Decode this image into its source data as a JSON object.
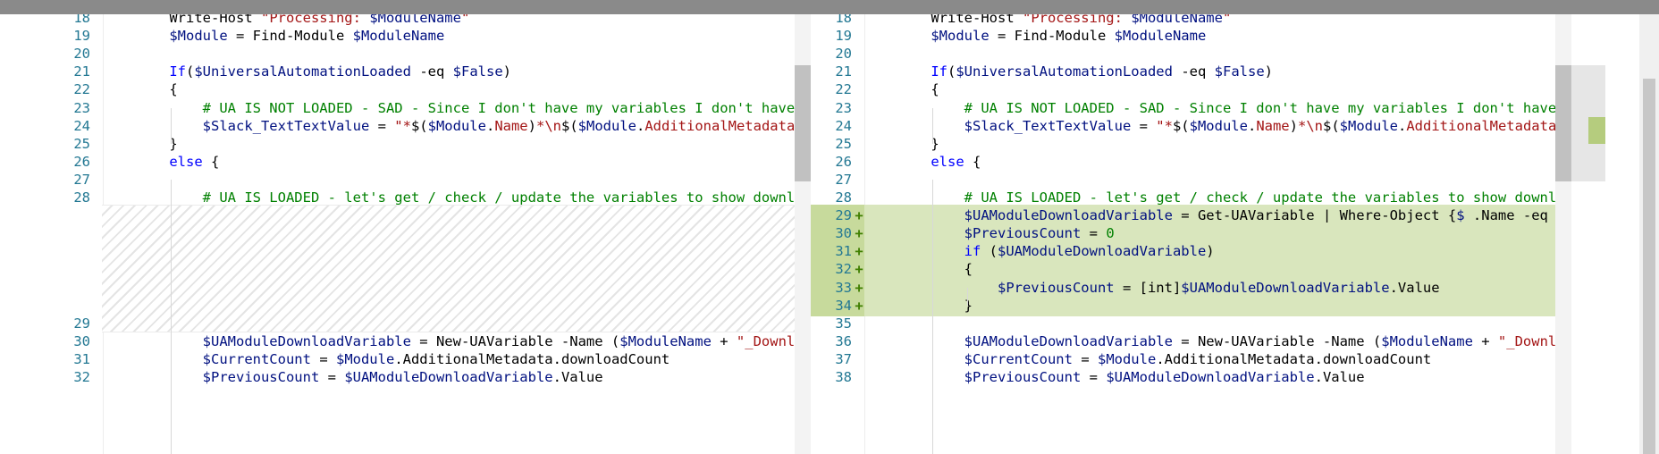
{
  "diff": {
    "left": {
      "lines": [
        {
          "num": "18",
          "segments": [
            {
              "t": "    Write-Host ",
              "c": "op"
            },
            {
              "t": "\"Processing: ",
              "c": "str"
            },
            {
              "t": "$ModuleName",
              "c": "var"
            },
            {
              "t": "\"",
              "c": "str"
            }
          ]
        },
        {
          "num": "19",
          "segments": [
            {
              "t": "    ",
              "c": "op"
            },
            {
              "t": "$Module",
              "c": "var"
            },
            {
              "t": " = Find-Module ",
              "c": "op"
            },
            {
              "t": "$ModuleName",
              "c": "var"
            }
          ]
        },
        {
          "num": "20",
          "segments": []
        },
        {
          "num": "21",
          "segments": [
            {
              "t": "    ",
              "c": "op"
            },
            {
              "t": "If",
              "c": "kw"
            },
            {
              "t": "(",
              "c": "op"
            },
            {
              "t": "$UniversalAutomationLoaded",
              "c": "var"
            },
            {
              "t": " -eq ",
              "c": "op"
            },
            {
              "t": "$False",
              "c": "var"
            },
            {
              "t": ")",
              "c": "op"
            }
          ]
        },
        {
          "num": "22",
          "segments": [
            {
              "t": "    {",
              "c": "op"
            }
          ]
        },
        {
          "num": "23",
          "segments": [
            {
              "t": "        # UA IS NOT LOADED - SAD - Since I don't have my variables I don't have a d",
              "c": "com"
            }
          ]
        },
        {
          "num": "24",
          "segments": [
            {
              "t": "        ",
              "c": "op"
            },
            {
              "t": "$Slack_TextTextValue",
              "c": "var"
            },
            {
              "t": " = ",
              "c": "op"
            },
            {
              "t": "\"*",
              "c": "str"
            },
            {
              "t": "$(",
              "c": "op"
            },
            {
              "t": "$Module",
              "c": "var"
            },
            {
              "t": ".",
              "c": "op"
            },
            {
              "t": "Name",
              "c": "str"
            },
            {
              "t": ")",
              "c": "op"
            },
            {
              "t": "*\\n",
              "c": "str"
            },
            {
              "t": "$(",
              "c": "op"
            },
            {
              "t": "$Module",
              "c": "var"
            },
            {
              "t": ".",
              "c": "op"
            },
            {
              "t": "AdditionalMetadata",
              "c": "str"
            },
            {
              "t": ".dow",
              "c": "op"
            }
          ]
        },
        {
          "num": "25",
          "segments": [
            {
              "t": "    }",
              "c": "op"
            }
          ]
        },
        {
          "num": "26",
          "segments": [
            {
              "t": "    ",
              "c": "op"
            },
            {
              "t": "else",
              "c": "kw"
            },
            {
              "t": " {",
              "c": "op"
            }
          ]
        },
        {
          "num": "27",
          "segments": []
        },
        {
          "num": "28",
          "segments": [
            {
              "t": "        # UA IS LOADED - let's get / check / update the variables to show download",
              "c": "com"
            }
          ]
        },
        {
          "num": "29",
          "segments": []
        },
        {
          "num": "30",
          "segments": [
            {
              "t": "        ",
              "c": "op"
            },
            {
              "t": "$UAModuleDownloadVariable",
              "c": "var"
            },
            {
              "t": " = New-UAVariable -Name (",
              "c": "op"
            },
            {
              "t": "$ModuleName",
              "c": "var"
            },
            {
              "t": " + ",
              "c": "op"
            },
            {
              "t": "\"_Downloads",
              "c": "str"
            }
          ]
        },
        {
          "num": "31",
          "segments": [
            {
              "t": "        ",
              "c": "op"
            },
            {
              "t": "$CurrentCount",
              "c": "var"
            },
            {
              "t": " = ",
              "c": "op"
            },
            {
              "t": "$Module",
              "c": "var"
            },
            {
              "t": ".AdditionalMetadata.downloadCount",
              "c": "op"
            }
          ]
        },
        {
          "num": "32",
          "segments": [
            {
              "t": "        ",
              "c": "op"
            },
            {
              "t": "$PreviousCount",
              "c": "var"
            },
            {
              "t": " = ",
              "c": "op"
            },
            {
              "t": "$UAModuleDownloadVariable",
              "c": "var"
            },
            {
              "t": ".Value",
              "c": "op"
            }
          ]
        }
      ]
    },
    "right": {
      "lines": [
        {
          "num": "18",
          "mark": "",
          "segments": [
            {
              "t": "    Write-Host ",
              "c": "op"
            },
            {
              "t": "\"Processing: ",
              "c": "str"
            },
            {
              "t": "$ModuleName",
              "c": "var"
            },
            {
              "t": "\"",
              "c": "str"
            }
          ]
        },
        {
          "num": "19",
          "mark": "",
          "segments": [
            {
              "t": "    ",
              "c": "op"
            },
            {
              "t": "$Module",
              "c": "var"
            },
            {
              "t": " = Find-Module ",
              "c": "op"
            },
            {
              "t": "$ModuleName",
              "c": "var"
            }
          ]
        },
        {
          "num": "20",
          "mark": "",
          "segments": []
        },
        {
          "num": "21",
          "mark": "",
          "segments": [
            {
              "t": "    ",
              "c": "op"
            },
            {
              "t": "If",
              "c": "kw"
            },
            {
              "t": "(",
              "c": "op"
            },
            {
              "t": "$UniversalAutomationLoaded",
              "c": "var"
            },
            {
              "t": " -eq ",
              "c": "op"
            },
            {
              "t": "$False",
              "c": "var"
            },
            {
              "t": ")",
              "c": "op"
            }
          ]
        },
        {
          "num": "22",
          "mark": "",
          "segments": [
            {
              "t": "    {",
              "c": "op"
            }
          ]
        },
        {
          "num": "23",
          "mark": "",
          "segments": [
            {
              "t": "        # UA IS NOT LOADED - SAD - Since I don't have my variables I don't have a d",
              "c": "com"
            }
          ]
        },
        {
          "num": "24",
          "mark": "",
          "segments": [
            {
              "t": "        ",
              "c": "op"
            },
            {
              "t": "$Slack_TextTextValue",
              "c": "var"
            },
            {
              "t": " = ",
              "c": "op"
            },
            {
              "t": "\"*",
              "c": "str"
            },
            {
              "t": "$(",
              "c": "op"
            },
            {
              "t": "$Module",
              "c": "var"
            },
            {
              "t": ".",
              "c": "op"
            },
            {
              "t": "Name",
              "c": "str"
            },
            {
              "t": ")",
              "c": "op"
            },
            {
              "t": "*\\n",
              "c": "str"
            },
            {
              "t": "$(",
              "c": "op"
            },
            {
              "t": "$Module",
              "c": "var"
            },
            {
              "t": ".",
              "c": "op"
            },
            {
              "t": "AdditionalMetadata",
              "c": "str"
            },
            {
              "t": ".dow",
              "c": "op"
            }
          ]
        },
        {
          "num": "25",
          "mark": "",
          "segments": [
            {
              "t": "    }",
              "c": "op"
            }
          ]
        },
        {
          "num": "26",
          "mark": "",
          "segments": [
            {
              "t": "    ",
              "c": "op"
            },
            {
              "t": "else",
              "c": "kw"
            },
            {
              "t": " {",
              "c": "op"
            }
          ]
        },
        {
          "num": "27",
          "mark": "",
          "segments": []
        },
        {
          "num": "28",
          "mark": "",
          "segments": [
            {
              "t": "        # UA IS LOADED - let's get / check / update the variables to show download",
              "c": "com"
            }
          ]
        },
        {
          "num": "29",
          "mark": "+",
          "added": true,
          "segments": [
            {
              "t": "        ",
              "c": "op"
            },
            {
              "t": "$UAModuleDownloadVariable",
              "c": "var"
            },
            {
              "t": " = Get-UAVariable | Where-Object {",
              "c": "op"
            },
            {
              "t": "$_",
              "c": "var"
            },
            {
              "t": ".Name -eq (",
              "c": "op"
            },
            {
              "t": "$Mo",
              "c": "var"
            }
          ]
        },
        {
          "num": "30",
          "mark": "+",
          "added": true,
          "segments": [
            {
              "t": "        ",
              "c": "op"
            },
            {
              "t": "$PreviousCount",
              "c": "var"
            },
            {
              "t": " = ",
              "c": "op"
            },
            {
              "t": "0",
              "c": "com"
            }
          ]
        },
        {
          "num": "31",
          "mark": "+",
          "added": true,
          "segments": [
            {
              "t": "        ",
              "c": "op"
            },
            {
              "t": "if",
              "c": "kw"
            },
            {
              "t": " (",
              "c": "op"
            },
            {
              "t": "$UAModuleDownloadVariable",
              "c": "var"
            },
            {
              "t": ")",
              "c": "op"
            }
          ]
        },
        {
          "num": "32",
          "mark": "+",
          "added": true,
          "segments": [
            {
              "t": "        {",
              "c": "op"
            }
          ]
        },
        {
          "num": "33",
          "mark": "+",
          "added": true,
          "segments": [
            {
              "t": "            ",
              "c": "op"
            },
            {
              "t": "$PreviousCount",
              "c": "var"
            },
            {
              "t": " = [int]",
              "c": "op"
            },
            {
              "t": "$UAModuleDownloadVariable",
              "c": "var"
            },
            {
              "t": ".Value",
              "c": "op"
            }
          ]
        },
        {
          "num": "34",
          "mark": "+",
          "added": true,
          "segments": [
            {
              "t": "        }",
              "c": "op"
            }
          ]
        },
        {
          "num": "35",
          "mark": "",
          "segments": []
        },
        {
          "num": "36",
          "mark": "",
          "segments": [
            {
              "t": "        ",
              "c": "op"
            },
            {
              "t": "$UAModuleDownloadVariable",
              "c": "var"
            },
            {
              "t": " = New-UAVariable -Name (",
              "c": "op"
            },
            {
              "t": "$ModuleName",
              "c": "var"
            },
            {
              "t": " + ",
              "c": "op"
            },
            {
              "t": "\"_Downloads",
              "c": "str"
            }
          ]
        },
        {
          "num": "37",
          "mark": "",
          "segments": [
            {
              "t": "        ",
              "c": "op"
            },
            {
              "t": "$CurrentCount",
              "c": "var"
            },
            {
              "t": " = ",
              "c": "op"
            },
            {
              "t": "$Module",
              "c": "var"
            },
            {
              "t": ".AdditionalMetadata.downloadCount",
              "c": "op"
            }
          ]
        },
        {
          "num": "38",
          "mark": "",
          "segments": [
            {
              "t": "        ",
              "c": "op"
            },
            {
              "t": "$PreviousCount",
              "c": "var"
            },
            {
              "t": " = ",
              "c": "op"
            },
            {
              "t": "$UAModuleDownloadVariable",
              "c": "var"
            },
            {
              "t": ".Value",
              "c": "op"
            }
          ]
        }
      ]
    }
  },
  "colors": {
    "added_line": "#d9e6bd",
    "added_gutter": "#c7da9c",
    "keyword": "#0000ff",
    "variable": "#001080",
    "string": "#a31515",
    "comment": "#008000",
    "line_number": "#237893"
  }
}
